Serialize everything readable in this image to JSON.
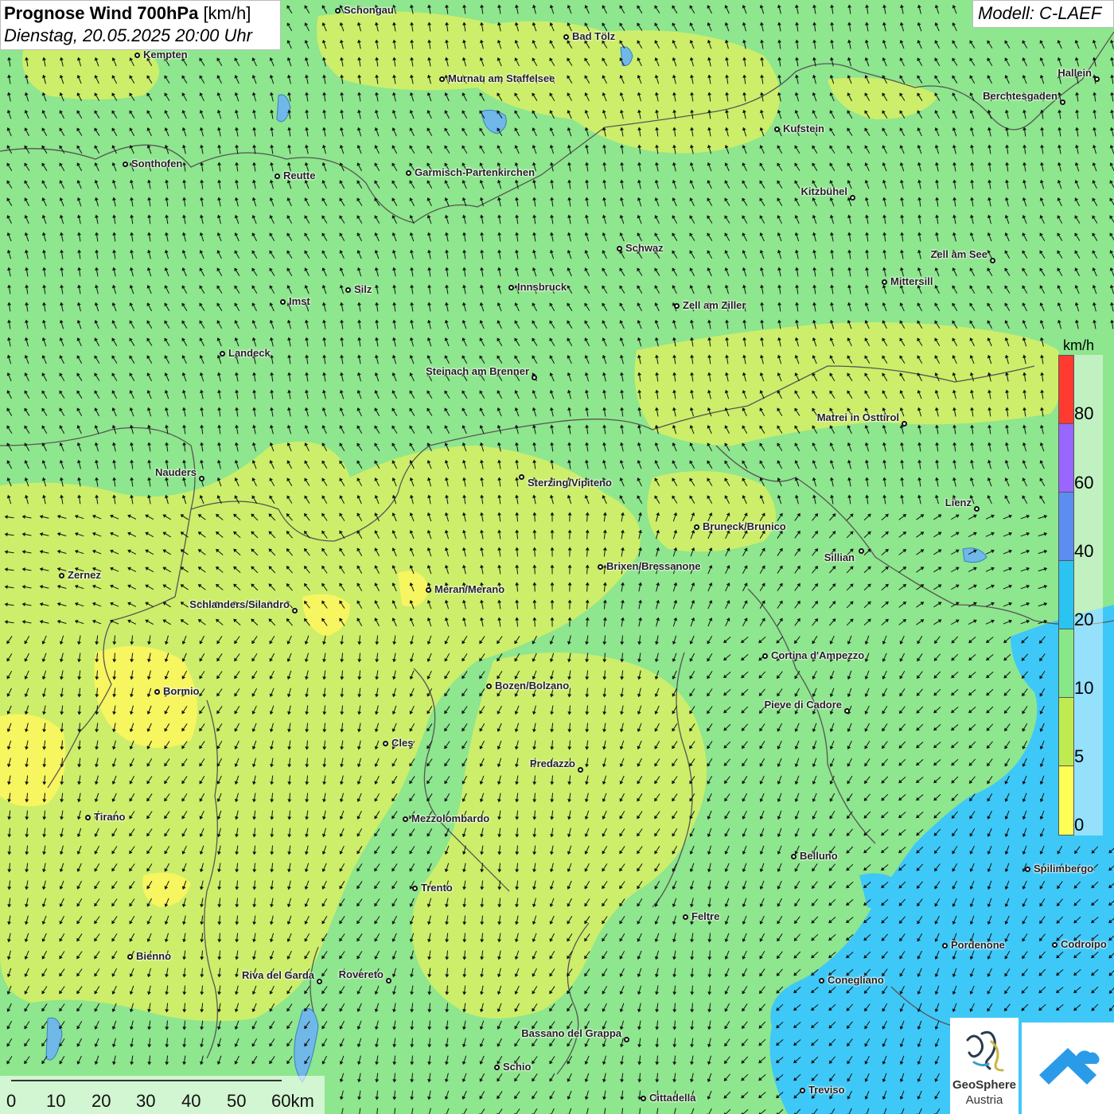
{
  "header": {
    "title_bold": "Prognose Wind 700hPa",
    "title_unit": "[km/h]",
    "datetime": "Dienstag, 20.05.2025 20:00 Uhr",
    "model": "Modell: C-LAEF"
  },
  "legend": {
    "unit": "km/h",
    "ticks": [
      "80",
      "60",
      "40",
      "20",
      "10",
      "5",
      "0"
    ],
    "colors": [
      "#ff3b30",
      "#9966ff",
      "#5b8ef0",
      "#2bc4f0",
      "#88e888",
      "#bfeb50",
      "#ffff55"
    ]
  },
  "scale_bar": {
    "labels": [
      "0",
      "10",
      "20",
      "30",
      "40",
      "50",
      "60km"
    ]
  },
  "logos": {
    "geosphere_name": "GeoSphere",
    "geosphere_sub": "Austria"
  },
  "colors": {
    "calm_green": "#8ee68e",
    "light_wind_yellow": "#d8f070",
    "very_calm_yellow": "#ffff66",
    "stronger_blue": "#3ec8f8",
    "lake_blue": "#5fb8e8",
    "border_gray": "#555555"
  },
  "cities": [
    {
      "name": "Schongau"
    },
    {
      "name": "Kempten"
    },
    {
      "name": "Bad Tölz"
    },
    {
      "name": "Murnau am Staffelsee"
    },
    {
      "name": "Hallein"
    },
    {
      "name": "Berchtesgaden"
    },
    {
      "name": "Kufstein"
    },
    {
      "name": "Sonthofen"
    },
    {
      "name": "Reutte"
    },
    {
      "name": "Garmisch-Partenkirchen"
    },
    {
      "name": "Kitzbühel"
    },
    {
      "name": "Schwaz"
    },
    {
      "name": "Zell am See"
    },
    {
      "name": "Mittersill"
    },
    {
      "name": "Innsbruck"
    },
    {
      "name": "Silz"
    },
    {
      "name": "Imst"
    },
    {
      "name": "Zell am Ziller"
    },
    {
      "name": "Landeck"
    },
    {
      "name": "Steinach am Brenner"
    },
    {
      "name": "Matrei in Osttirol"
    },
    {
      "name": "Nauders"
    },
    {
      "name": "Sterzing/Vipiteno"
    },
    {
      "name": "Lienz"
    },
    {
      "name": "Bruneck/Brunico"
    },
    {
      "name": "Sillian"
    },
    {
      "name": "Zernez"
    },
    {
      "name": "Brixen/Bressanone"
    },
    {
      "name": "Meran/Merano"
    },
    {
      "name": "Schlanders/Silandro"
    },
    {
      "name": "Cortina d'Ampezzo"
    },
    {
      "name": "Bozen/Bolzano"
    },
    {
      "name": "Bormio"
    },
    {
      "name": "Pieve di Cadore"
    },
    {
      "name": "Cles"
    },
    {
      "name": "Predazzo"
    },
    {
      "name": "Tirano"
    },
    {
      "name": "Mezzolombardo"
    },
    {
      "name": "Belluno"
    },
    {
      "name": "Spilimbergo"
    },
    {
      "name": "Trento"
    },
    {
      "name": "Feltre"
    },
    {
      "name": "Pordenone"
    },
    {
      "name": "Codroipo"
    },
    {
      "name": "Bienno"
    },
    {
      "name": "Riva del Garda"
    },
    {
      "name": "Rovereto"
    },
    {
      "name": "Conegliano"
    },
    {
      "name": "Bassano del Grappa"
    },
    {
      "name": "Schio"
    },
    {
      "name": "Treviso"
    },
    {
      "name": "Cittadella"
    }
  ]
}
